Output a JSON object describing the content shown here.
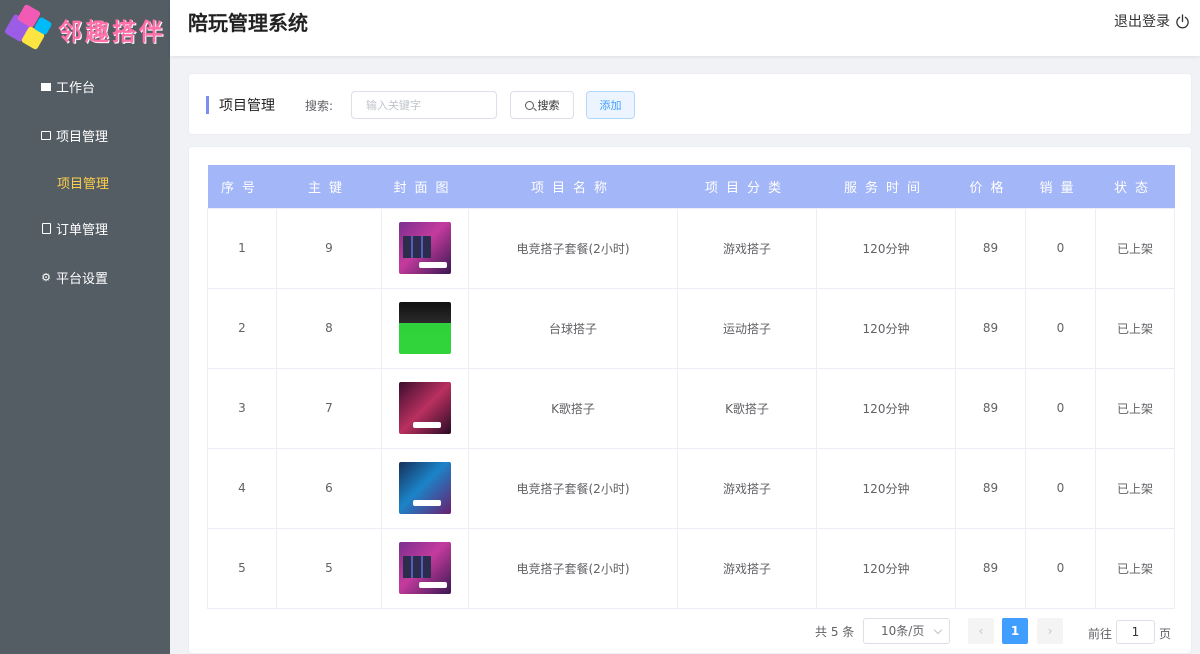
{
  "app": {
    "logo_text": "邻趣搭伴",
    "title": "陪玩管理系统",
    "logout_label": "退出登录"
  },
  "sidebar": {
    "items": [
      {
        "label": "工作台",
        "icon": "monitor-icon"
      },
      {
        "label": "项目管理",
        "icon": "box-icon"
      },
      {
        "label": "项目管理",
        "icon": "",
        "sub": true,
        "active": true
      },
      {
        "label": "订单管理",
        "icon": "document-icon"
      },
      {
        "label": "平台设置",
        "icon": "gear-icon"
      }
    ]
  },
  "search": {
    "section_title": "项目管理",
    "label": "搜索:",
    "placeholder": "输入关键字",
    "value": "",
    "search_button": "搜索",
    "add_button": "添加"
  },
  "table": {
    "headers": [
      "序号",
      "主键",
      "封面图",
      "项目名称",
      "项目分类",
      "服务时间",
      "价格",
      "销量",
      "状态"
    ],
    "rows": [
      {
        "index": "1",
        "id": "9",
        "cover": "esports-cover",
        "name": "电竞搭子套餐(2小时)",
        "category": "游戏搭子",
        "duration": "120分钟",
        "price": "89",
        "sales": "0",
        "status": "已上架"
      },
      {
        "index": "2",
        "id": "8",
        "cover": "pool-cover",
        "name": "台球搭子",
        "category": "运动搭子",
        "duration": "120分钟",
        "price": "89",
        "sales": "0",
        "status": "已上架"
      },
      {
        "index": "3",
        "id": "7",
        "cover": "ktv-cover",
        "name": "K歌搭子",
        "category": "K歌搭子",
        "duration": "120分钟",
        "price": "89",
        "sales": "0",
        "status": "已上架"
      },
      {
        "index": "4",
        "id": "6",
        "cover": "esports2-cover",
        "name": "电竞搭子套餐(2小时)",
        "category": "游戏搭子",
        "duration": "120分钟",
        "price": "89",
        "sales": "0",
        "status": "已上架"
      },
      {
        "index": "5",
        "id": "5",
        "cover": "esports-cover",
        "name": "电竞搭子套餐(2小时)",
        "category": "游戏搭子",
        "duration": "120分钟",
        "price": "89",
        "sales": "0",
        "status": "已上架"
      }
    ]
  },
  "pagination": {
    "total_text": "共 5 条",
    "page_size": "10条/页",
    "prev": "‹",
    "current_page": "1",
    "next": "›",
    "goto_label": "前往",
    "goto_value": "1",
    "page_suffix": "页"
  },
  "colors": {
    "sidebar_bg": "#545c64",
    "active_menu": "#ffd04b",
    "table_header_bg": "#a3b6f7",
    "primary": "#409eff"
  }
}
